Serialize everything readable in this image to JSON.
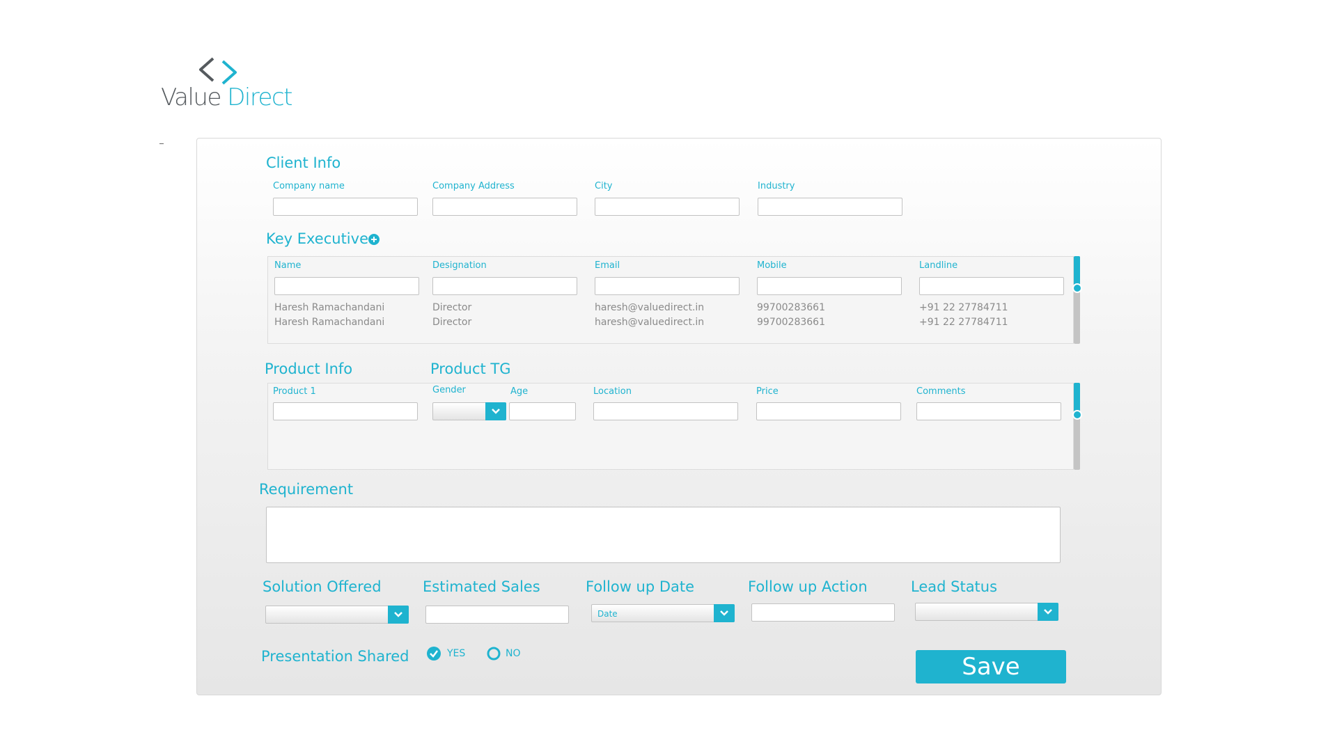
{
  "brand": {
    "word1": "Value",
    "word2": "Direct"
  },
  "client_info": {
    "title": "Client Info",
    "fields": [
      "Company name",
      "Company Address",
      "City",
      "Industry"
    ]
  },
  "key_executive": {
    "title": "Key Executive",
    "columns": [
      "Name",
      "Designation",
      "Email",
      "Mobile",
      "Landline"
    ],
    "rows": [
      [
        "Haresh Ramachandani",
        "Director",
        "haresh@valuedirect.in",
        "99700283661",
        "+91 22 27784711"
      ],
      [
        "Haresh Ramachandani",
        "Director",
        "haresh@valuedirect.in",
        "99700283661",
        "+91 22 27784711"
      ]
    ]
  },
  "product_info": {
    "title": "Product Info",
    "field": "Product 1"
  },
  "product_tg": {
    "title": "Product TG",
    "gender": "Gender",
    "age": "Age",
    "location": "Location",
    "price": "Price",
    "comments": "Comments"
  },
  "requirement": {
    "title": "Requirement"
  },
  "bottom": {
    "solution_offered": "Solution Offered",
    "estimated_sales": "Estimated Sales",
    "follow_up_date": "Follow up Date",
    "follow_up_date_value": "Date",
    "follow_up_action": "Follow up Action",
    "lead_status": "Lead Status"
  },
  "presentation": {
    "title": "Presentation Shared",
    "yes": "YES",
    "no": "NO",
    "selected": "YES"
  },
  "save_label": "Save",
  "colors": {
    "accent": "#1fb3cf",
    "logo_gray": "#555a5e",
    "row_text": "#8a8a8a"
  },
  "icons": [
    "logo-chevrons-icon",
    "add-circle-icon",
    "chevron-down-icon",
    "check-circle-icon",
    "radio-empty-icon"
  ]
}
